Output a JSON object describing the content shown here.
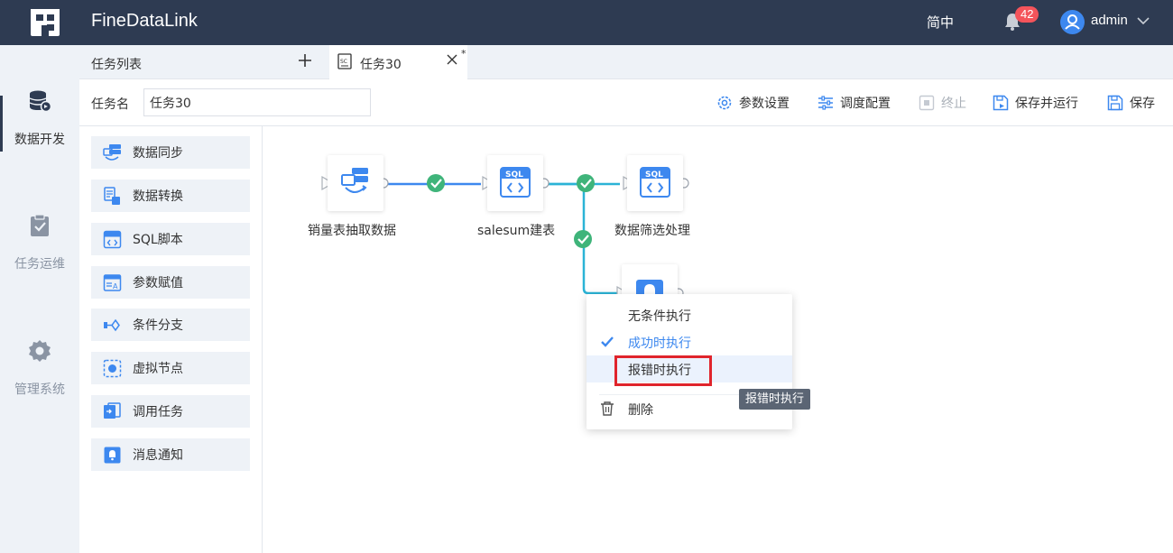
{
  "header": {
    "app_title": "FineDataLink",
    "language": "简中",
    "notification_count": "42",
    "user_name": "admin"
  },
  "rail": {
    "items": [
      {
        "label": "数据开发",
        "icon": "database-icon",
        "active": true
      },
      {
        "label": "任务运维",
        "icon": "clipboard-check-icon",
        "active": false
      },
      {
        "label": "管理系统",
        "icon": "gear-icon",
        "active": false
      }
    ]
  },
  "tabs": {
    "list_label": "任务列表",
    "active_tab": "任务30",
    "modified_mark": "*"
  },
  "toolbar": {
    "task_name_label": "任务名",
    "task_name_value": "任务30",
    "param_settings": "参数设置",
    "schedule_config": "调度配置",
    "stop": "终止",
    "save_run": "保存并运行",
    "save": "保存"
  },
  "palette": {
    "items": [
      {
        "label": "数据同步",
        "icon": "data-sync-icon"
      },
      {
        "label": "数据转换",
        "icon": "data-transform-icon"
      },
      {
        "label": "SQL脚本",
        "icon": "sql-script-icon"
      },
      {
        "label": "参数赋值",
        "icon": "param-assign-icon"
      },
      {
        "label": "条件分支",
        "icon": "condition-branch-icon"
      },
      {
        "label": "虚拟节点",
        "icon": "virtual-node-icon"
      },
      {
        "label": "调用任务",
        "icon": "call-task-icon"
      },
      {
        "label": "消息通知",
        "icon": "notify-icon"
      }
    ]
  },
  "canvas": {
    "nodes": [
      {
        "label": "销量表抽取数据",
        "icon": "data-sync-node-icon"
      },
      {
        "label": "salesum建表",
        "icon": "sql-node-icon"
      },
      {
        "label": "数据筛选处理",
        "icon": "sql-node-icon"
      },
      {
        "label": "",
        "icon": "notify-node-icon"
      }
    ]
  },
  "context_menu": {
    "items": [
      {
        "label": "无条件执行",
        "checked": false
      },
      {
        "label": "成功时执行",
        "checked": true
      },
      {
        "label": "报错时执行",
        "checked": false,
        "hovered": true
      },
      {
        "label": "删除",
        "icon": "trash-icon"
      }
    ],
    "tooltip": "报错时执行"
  },
  "colors": {
    "header_bg": "#2e3b52",
    "accent": "#3d88ef",
    "success": "#3fb47a",
    "badge": "#f4545b",
    "highlight": "#e0242c"
  }
}
